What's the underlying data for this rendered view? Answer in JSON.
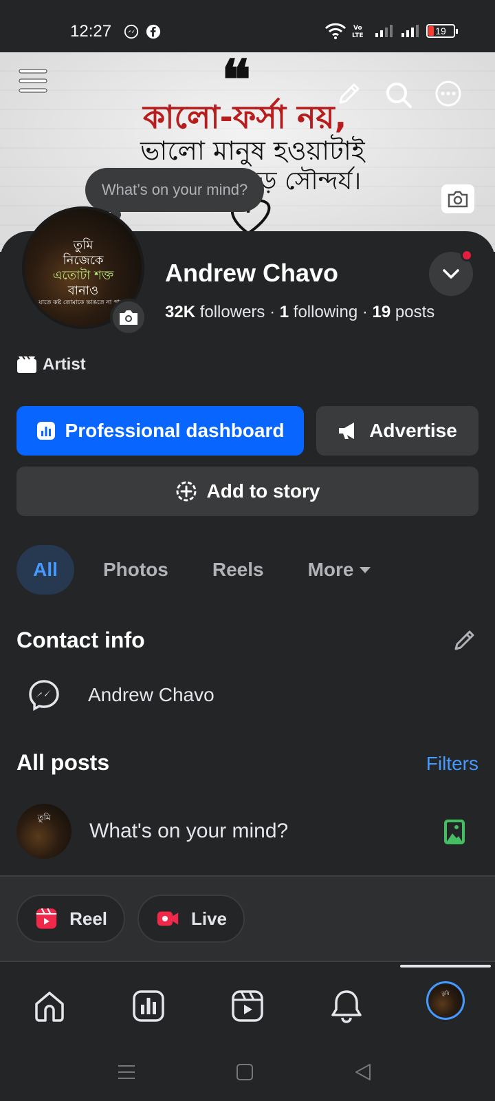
{
  "status_bar": {
    "time": "12:27",
    "battery": "19",
    "network_label": "Vo LTE2"
  },
  "cover": {
    "line1": "কালো-ফর্সা নয়,",
    "line2": "ভালো মানুষ হওয়াটাই",
    "line3": "সবচেয়ে বড় সৌন্দর্য।",
    "quote_mark": "❝"
  },
  "tooltip": "What’s on your mind?",
  "avatar_text": {
    "l1": "তুমি",
    "l2": "নিজেকে",
    "l3": "এতোটা শক্ত",
    "l4": "বানাও",
    "l5": "যাতে কষ্ট তোমাকে ভাঙতে না পারে।"
  },
  "profile": {
    "name": "Andrew Chavo",
    "followers_count": "32K",
    "followers_label": "followers",
    "following_count": "1",
    "following_label": "following",
    "posts_count": "19",
    "posts_label": "posts",
    "separator": "·",
    "category": "Artist"
  },
  "buttons": {
    "professional_dashboard": "Professional dashboard",
    "advertise": "Advertise",
    "add_to_story": "Add to story"
  },
  "tabs": [
    {
      "label": "All",
      "active": true
    },
    {
      "label": "Photos",
      "active": false
    },
    {
      "label": "Reels",
      "active": false
    },
    {
      "label": "More",
      "active": false
    }
  ],
  "contact": {
    "title": "Contact info",
    "messenger_name": "Andrew Chavo"
  },
  "posts": {
    "title": "All posts",
    "filters": "Filters",
    "composer_placeholder": "What's on your mind?"
  },
  "actions": {
    "reel": "Reel",
    "live": "Live"
  },
  "colors": {
    "accent": "#0866ff",
    "link": "#4599ff",
    "background": "#242526",
    "surface": "#3a3b3c",
    "notification": "#e41e3f",
    "reel": "#f02849",
    "photo": "#45bd62"
  }
}
